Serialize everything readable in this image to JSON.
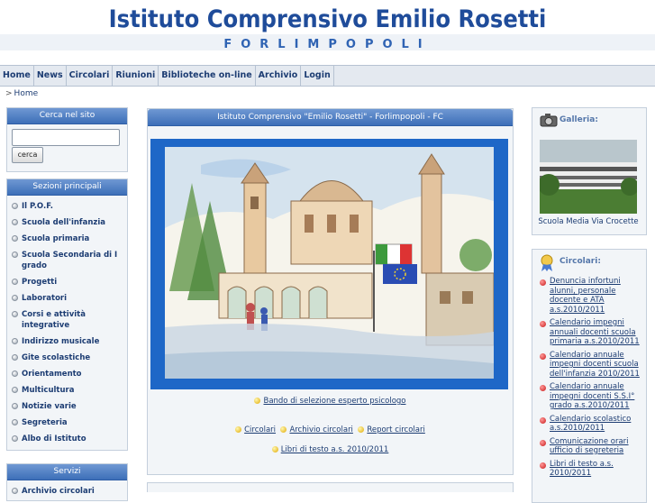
{
  "header": {
    "title": "Istituto Comprensivo Emilio Rosetti",
    "subtitle": "FORLIMPOPOLI"
  },
  "topnav": {
    "items": [
      "Home",
      "News",
      "Circolari",
      "Riunioni",
      "Biblioteche on-line",
      "Archivio",
      "Login"
    ]
  },
  "breadcrumb": {
    "arrow": ">",
    "current": "Home"
  },
  "search_box": {
    "title": "Cerca nel sito",
    "input_value": "",
    "button_label": "cerca"
  },
  "sections_box": {
    "title": "Sezioni principali",
    "items": [
      "Il P.O.F.",
      "Scuola dell'infanzia",
      "Scuola primaria",
      "Scuola Secondaria di I grado",
      "Progetti",
      "Laboratori",
      "Corsi e attività integrative",
      "Indirizzo musicale",
      "Gite scolastiche",
      "Orientamento",
      "Multicultura",
      "Notizie varie",
      "Segreteria",
      "Albo di Istituto"
    ]
  },
  "services_box": {
    "title": "Servizi",
    "items": [
      "Archivio circolari"
    ]
  },
  "center": {
    "title": "Istituto Comprensivo \"Emilio Rosetti\" - Forlimpopoli - FC",
    "link_bando": "Bando di selezione esperto psicologo",
    "link_circolari": "Circolari",
    "link_archivio": "Archivio circolari",
    "link_report": "Report circolari",
    "link_libri": "Libri di testo a.s. 2010/2011"
  },
  "gallery_box": {
    "title": "Galleria:",
    "caption": "Scuola Media Via Crocette"
  },
  "circolari_box": {
    "title": "Circolari:",
    "items": [
      "Denuncia infortuni alunni, personale docente e ATA a.s.2010/2011",
      "Calendario impegni annuali docenti scuola primaria a.s.2010/2011",
      "Calendario annuale impegni docenti scuola dell'infanzia 2010/2011",
      "Calendario annuale impegni docenti S.S.I° grado a.s.2010/2011",
      "Calendario scolastico a.s.2010/2011",
      "Comunicazione orari ufficio di segreteria",
      "Libri di testo a.s. 2010/2011"
    ]
  },
  "colors": {
    "accent": "#1f4c9a",
    "box_header": "#3d6fb8",
    "nav_bg": "#e4e9f0",
    "painting_frame": "#1e67c7"
  }
}
